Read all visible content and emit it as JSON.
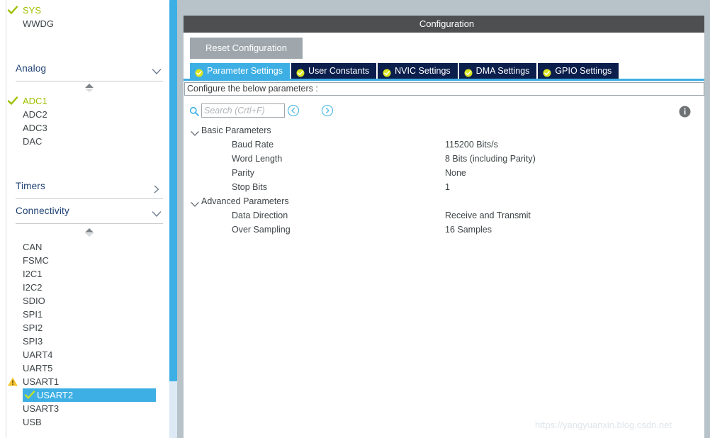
{
  "sidebar": {
    "top_items": [
      {
        "label": "SYS",
        "state": "checked"
      },
      {
        "label": "WWDG",
        "state": "none"
      }
    ],
    "sections": [
      {
        "label": "Analog",
        "expanded": true,
        "chevron": "chevron-down-icon"
      },
      {
        "label": "Timers",
        "expanded": false,
        "chevron": "chevron-right-icon"
      },
      {
        "label": "Connectivity",
        "expanded": true,
        "chevron": "chevron-down-icon"
      }
    ],
    "analog_items": [
      {
        "label": "ADC1",
        "state": "checked"
      },
      {
        "label": "ADC2",
        "state": "none"
      },
      {
        "label": "ADC3",
        "state": "none"
      },
      {
        "label": "DAC",
        "state": "none"
      }
    ],
    "connectivity_items": [
      {
        "label": "CAN",
        "state": "none"
      },
      {
        "label": "FSMC",
        "state": "none"
      },
      {
        "label": "I2C1",
        "state": "none"
      },
      {
        "label": "I2C2",
        "state": "none"
      },
      {
        "label": "SDIO",
        "state": "none"
      },
      {
        "label": "SPI1",
        "state": "none"
      },
      {
        "label": "SPI2",
        "state": "none"
      },
      {
        "label": "SPI3",
        "state": "none"
      },
      {
        "label": "UART4",
        "state": "none"
      },
      {
        "label": "UART5",
        "state": "none"
      },
      {
        "label": "USART1",
        "state": "warning"
      },
      {
        "label": "USART2",
        "state": "checked",
        "selected": true
      },
      {
        "label": "USART3",
        "state": "none"
      },
      {
        "label": "USB",
        "state": "none"
      }
    ],
    "colors": {
      "checked": "#9ec000",
      "warning": "#f5c431",
      "selected_bg": "#3dafe4",
      "section_title": "#1c3f73",
      "scrollbar_thumb": "#3dafe4",
      "scrollbar_track": "#ddeaf6"
    }
  },
  "config": {
    "title": "Configuration",
    "reset_label": "Reset Configuration",
    "tabs": [
      {
        "label": "Parameter Settings",
        "active": true,
        "badge": "check-badge-icon"
      },
      {
        "label": "User Constants",
        "active": false,
        "badge": "check-badge-icon"
      },
      {
        "label": "NVIC Settings",
        "active": false,
        "badge": "check-badge-icon"
      },
      {
        "label": "DMA Settings",
        "active": false,
        "badge": "check-badge-icon"
      },
      {
        "label": "GPIO Settings",
        "active": false,
        "badge": "check-badge-icon"
      }
    ],
    "description": "Configure the below parameters :",
    "search": {
      "value": "",
      "placeholder": "Search (Crtl+F)"
    },
    "nav": {
      "prev": "chevron-left-circle-icon",
      "next": "chevron-right-circle-icon"
    },
    "info": "info-icon",
    "groups": [
      {
        "name": "Basic Parameters",
        "expanded": true,
        "rows": [
          {
            "name": "Baud Rate",
            "value": "115200 Bits/s"
          },
          {
            "name": "Word Length",
            "value": "8 Bits (including Parity)"
          },
          {
            "name": "Parity",
            "value": "None"
          },
          {
            "name": "Stop Bits",
            "value": "1"
          }
        ]
      },
      {
        "name": "Advanced Parameters",
        "expanded": true,
        "rows": [
          {
            "name": "Data Direction",
            "value": "Receive and Transmit"
          },
          {
            "name": "Over Sampling",
            "value": "16 Samples"
          }
        ]
      }
    ],
    "colors": {
      "title_bar": "#4d4f50",
      "tab_active": "#3dafe4",
      "tab_inactive": "#0b1e4c",
      "reset_button": "#9fa7ad",
      "accent": "#3dafe4"
    }
  },
  "watermark": "https://yangyuanxin.blog.csdn.net"
}
